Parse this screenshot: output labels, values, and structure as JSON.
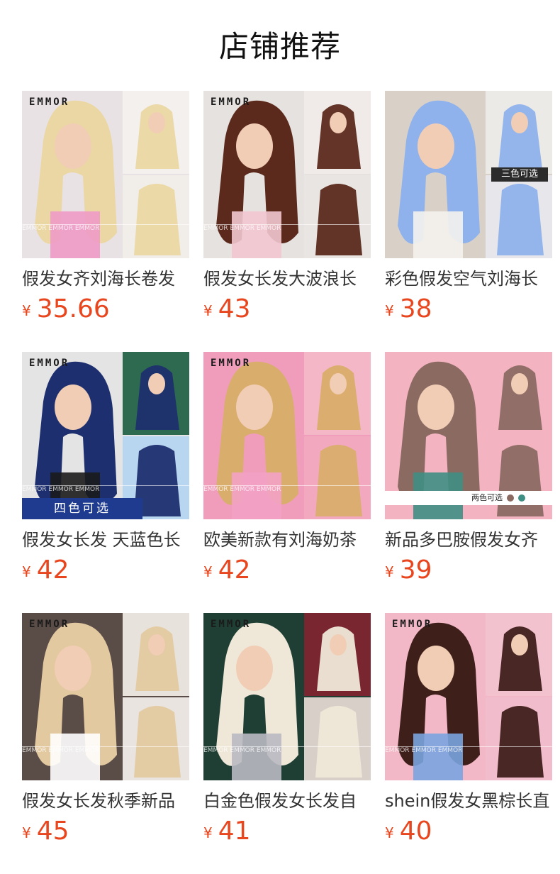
{
  "page": {
    "title": "店铺推荐"
  },
  "currency": "¥",
  "products": [
    {
      "name": "假发女齐刘海长卷发",
      "price": "35.66",
      "image": {
        "brand": "EMMOR",
        "watermark": "EMMOR",
        "badge": "",
        "bg": "#e9e2e4",
        "hair": "#ead7a3",
        "panels": [
          "#f3f0ee",
          "#f1eee9"
        ],
        "accent": "#ee9bc6"
      }
    },
    {
      "name": "假发女长发大波浪长",
      "price": "43",
      "image": {
        "brand": "EMMOR",
        "watermark": "EMMOR",
        "badge": "",
        "bg": "#e6e2df",
        "hair": "#5b2a1c",
        "panels": [
          "#f0ebe8",
          "#e9e5e2"
        ],
        "accent": "#f2c7d0"
      }
    },
    {
      "name": "彩色假发空气刘海长",
      "price": "38",
      "image": {
        "brand": "",
        "watermark": "",
        "badge": "三色可选",
        "bg": "#d9d1c7",
        "hair": "#8fb2ec",
        "panels": [
          "#eceae6",
          "#e7e6ea"
        ],
        "accent": "#f4f2ee"
      }
    },
    {
      "name": "假发女长发 天蓝色长",
      "price": "42",
      "image": {
        "brand": "EMMOR",
        "watermark": "EMMOR",
        "badge": "四色可选",
        "bg": "#e5e4e4",
        "hair": "#1d2f6e",
        "panels": [
          "#2d6a50",
          "#b8d6ef"
        ],
        "accent": "#1b1b1b"
      }
    },
    {
      "name": "欧美新款有刘海奶茶",
      "price": "42",
      "image": {
        "brand": "EMMOR",
        "watermark": "EMMOR",
        "badge": "",
        "bg": "#ef9dbb",
        "hair": "#d9ad6c",
        "panels": [
          "#f4b7c8",
          "#f2a9c0"
        ],
        "accent": "#f3a1c6"
      }
    },
    {
      "name": "新品多巴胺假发女齐",
      "price": "39",
      "image": {
        "brand": "",
        "watermark": "",
        "badge": "",
        "caption": "两色可选",
        "bg": "#f4b3c1",
        "hair": "#8b6a62",
        "panels": [
          "#f4b3c1",
          "#f4b3c1"
        ],
        "accent": "#3f8f84"
      }
    },
    {
      "name": "假发女长发秋季新品",
      "price": "45",
      "image": {
        "brand": "EMMOR",
        "watermark": "EMMOR",
        "badge": "",
        "bg": "#5a4c46",
        "hair": "#e3c9a0",
        "panels": [
          "#e8e2dc",
          "#e9e4e0"
        ],
        "accent": "#ffffff"
      }
    },
    {
      "name": "白金色假发女长发自",
      "price": "41",
      "image": {
        "brand": "EMMOR",
        "watermark": "EMMOR",
        "badge": "",
        "bg": "#1f3f35",
        "hair": "#efe8d8",
        "panels": [
          "#7a2630",
          "#d8d0c8"
        ],
        "accent": "#b9b9c2"
      }
    },
    {
      "name": "shein假发女黑棕长直",
      "price": "40",
      "image": {
        "brand": "EMMOR",
        "watermark": "EMMOR",
        "badge": "",
        "bg": "#f3b8c7",
        "hair": "#3f1f1a",
        "panels": [
          "#f3c2cf",
          "#f1bccb"
        ],
        "accent": "#7aa4df"
      }
    }
  ]
}
